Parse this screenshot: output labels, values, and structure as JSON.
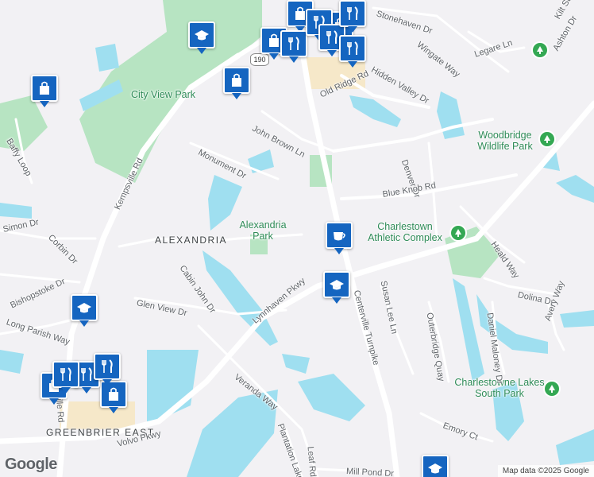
{
  "map": {
    "colors": {
      "water": "#9fdff0",
      "park": "#b7e4c2",
      "road": "#ffffff",
      "land": "#f2f1f4",
      "poi": "#1565c0"
    },
    "route_shield": "190",
    "areas": [
      "ALEXANDRIA",
      "GREENBRIER EAST"
    ],
    "parks": [
      "City View Park",
      "Alexandria Park",
      "Woodbridge Wildlife Park",
      "Charlestown Athletic Complex",
      "Charlestowne Lakes South Park"
    ],
    "roads": [
      "Stonehaven Dr",
      "Kilt St",
      "Ashton Dr",
      "Legare Ln",
      "Wingate Way",
      "Hidden Valley Dr",
      "Old Ridge Rd",
      "John Brown Ln",
      "Monument Dr",
      "Baffy Loop",
      "Kempsville Rd",
      "Denver Dr",
      "Blue Knob Rd",
      "Simon Dr",
      "Corbin Dr",
      "Cabin John Dr",
      "Heald Way",
      "Bishopstoke Dr",
      "Long Parish Way",
      "Glen View Dr",
      "Lynnhaven Pkwy",
      "Centerville Turnpike",
      "Susan Lee Ln",
      "Outerbridge Quay",
      "Daniel Maloney Dr",
      "Dolina Dr",
      "Avery Way",
      "Veranda Way",
      "Plantation Lakes",
      "Emory Ct",
      "Volvo Pkwy",
      "Mill Pond Dr",
      "Leaf Rd",
      "Kempsville Rd"
    ],
    "poi_icons": [
      "school-icon",
      "shopping-bag-icon",
      "restaurant-icon",
      "coffee-icon"
    ],
    "attribution": "Map data ©2025 Google",
    "logo": "Google"
  }
}
